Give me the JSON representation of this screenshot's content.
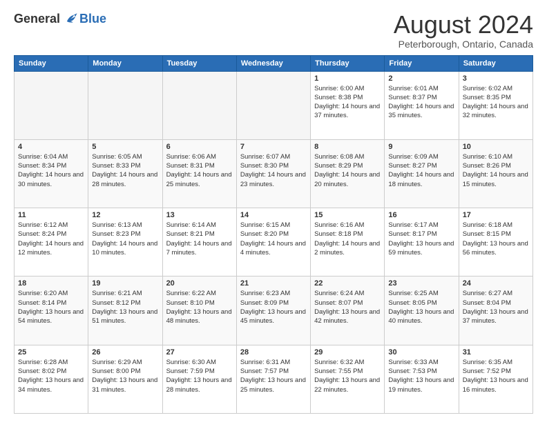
{
  "logo": {
    "general": "General",
    "blue": "Blue"
  },
  "header": {
    "title": "August 2024",
    "location": "Peterborough, Ontario, Canada"
  },
  "weekdays": [
    "Sunday",
    "Monday",
    "Tuesday",
    "Wednesday",
    "Thursday",
    "Friday",
    "Saturday"
  ],
  "weeks": [
    [
      {
        "day": "",
        "empty": true
      },
      {
        "day": "",
        "empty": true
      },
      {
        "day": "",
        "empty": true
      },
      {
        "day": "",
        "empty": true
      },
      {
        "day": "1",
        "sunrise": "6:00 AM",
        "sunset": "8:38 PM",
        "daylight": "14 hours and 37 minutes."
      },
      {
        "day": "2",
        "sunrise": "6:01 AM",
        "sunset": "8:37 PM",
        "daylight": "14 hours and 35 minutes."
      },
      {
        "day": "3",
        "sunrise": "6:02 AM",
        "sunset": "8:35 PM",
        "daylight": "14 hours and 32 minutes."
      }
    ],
    [
      {
        "day": "4",
        "sunrise": "6:04 AM",
        "sunset": "8:34 PM",
        "daylight": "14 hours and 30 minutes."
      },
      {
        "day": "5",
        "sunrise": "6:05 AM",
        "sunset": "8:33 PM",
        "daylight": "14 hours and 28 minutes."
      },
      {
        "day": "6",
        "sunrise": "6:06 AM",
        "sunset": "8:31 PM",
        "daylight": "14 hours and 25 minutes."
      },
      {
        "day": "7",
        "sunrise": "6:07 AM",
        "sunset": "8:30 PM",
        "daylight": "14 hours and 23 minutes."
      },
      {
        "day": "8",
        "sunrise": "6:08 AM",
        "sunset": "8:29 PM",
        "daylight": "14 hours and 20 minutes."
      },
      {
        "day": "9",
        "sunrise": "6:09 AM",
        "sunset": "8:27 PM",
        "daylight": "14 hours and 18 minutes."
      },
      {
        "day": "10",
        "sunrise": "6:10 AM",
        "sunset": "8:26 PM",
        "daylight": "14 hours and 15 minutes."
      }
    ],
    [
      {
        "day": "11",
        "sunrise": "6:12 AM",
        "sunset": "8:24 PM",
        "daylight": "14 hours and 12 minutes."
      },
      {
        "day": "12",
        "sunrise": "6:13 AM",
        "sunset": "8:23 PM",
        "daylight": "14 hours and 10 minutes."
      },
      {
        "day": "13",
        "sunrise": "6:14 AM",
        "sunset": "8:21 PM",
        "daylight": "14 hours and 7 minutes."
      },
      {
        "day": "14",
        "sunrise": "6:15 AM",
        "sunset": "8:20 PM",
        "daylight": "14 hours and 4 minutes."
      },
      {
        "day": "15",
        "sunrise": "6:16 AM",
        "sunset": "8:18 PM",
        "daylight": "14 hours and 2 minutes."
      },
      {
        "day": "16",
        "sunrise": "6:17 AM",
        "sunset": "8:17 PM",
        "daylight": "13 hours and 59 minutes."
      },
      {
        "day": "17",
        "sunrise": "6:18 AM",
        "sunset": "8:15 PM",
        "daylight": "13 hours and 56 minutes."
      }
    ],
    [
      {
        "day": "18",
        "sunrise": "6:20 AM",
        "sunset": "8:14 PM",
        "daylight": "13 hours and 54 minutes."
      },
      {
        "day": "19",
        "sunrise": "6:21 AM",
        "sunset": "8:12 PM",
        "daylight": "13 hours and 51 minutes."
      },
      {
        "day": "20",
        "sunrise": "6:22 AM",
        "sunset": "8:10 PM",
        "daylight": "13 hours and 48 minutes."
      },
      {
        "day": "21",
        "sunrise": "6:23 AM",
        "sunset": "8:09 PM",
        "daylight": "13 hours and 45 minutes."
      },
      {
        "day": "22",
        "sunrise": "6:24 AM",
        "sunset": "8:07 PM",
        "daylight": "13 hours and 42 minutes."
      },
      {
        "day": "23",
        "sunrise": "6:25 AM",
        "sunset": "8:05 PM",
        "daylight": "13 hours and 40 minutes."
      },
      {
        "day": "24",
        "sunrise": "6:27 AM",
        "sunset": "8:04 PM",
        "daylight": "13 hours and 37 minutes."
      }
    ],
    [
      {
        "day": "25",
        "sunrise": "6:28 AM",
        "sunset": "8:02 PM",
        "daylight": "13 hours and 34 minutes."
      },
      {
        "day": "26",
        "sunrise": "6:29 AM",
        "sunset": "8:00 PM",
        "daylight": "13 hours and 31 minutes."
      },
      {
        "day": "27",
        "sunrise": "6:30 AM",
        "sunset": "7:59 PM",
        "daylight": "13 hours and 28 minutes."
      },
      {
        "day": "28",
        "sunrise": "6:31 AM",
        "sunset": "7:57 PM",
        "daylight": "13 hours and 25 minutes."
      },
      {
        "day": "29",
        "sunrise": "6:32 AM",
        "sunset": "7:55 PM",
        "daylight": "13 hours and 22 minutes."
      },
      {
        "day": "30",
        "sunrise": "6:33 AM",
        "sunset": "7:53 PM",
        "daylight": "13 hours and 19 minutes."
      },
      {
        "day": "31",
        "sunrise": "6:35 AM",
        "sunset": "7:52 PM",
        "daylight": "13 hours and 16 minutes."
      }
    ]
  ],
  "labels": {
    "sunrise": "Sunrise:",
    "sunset": "Sunset:",
    "daylight": "Daylight:"
  }
}
